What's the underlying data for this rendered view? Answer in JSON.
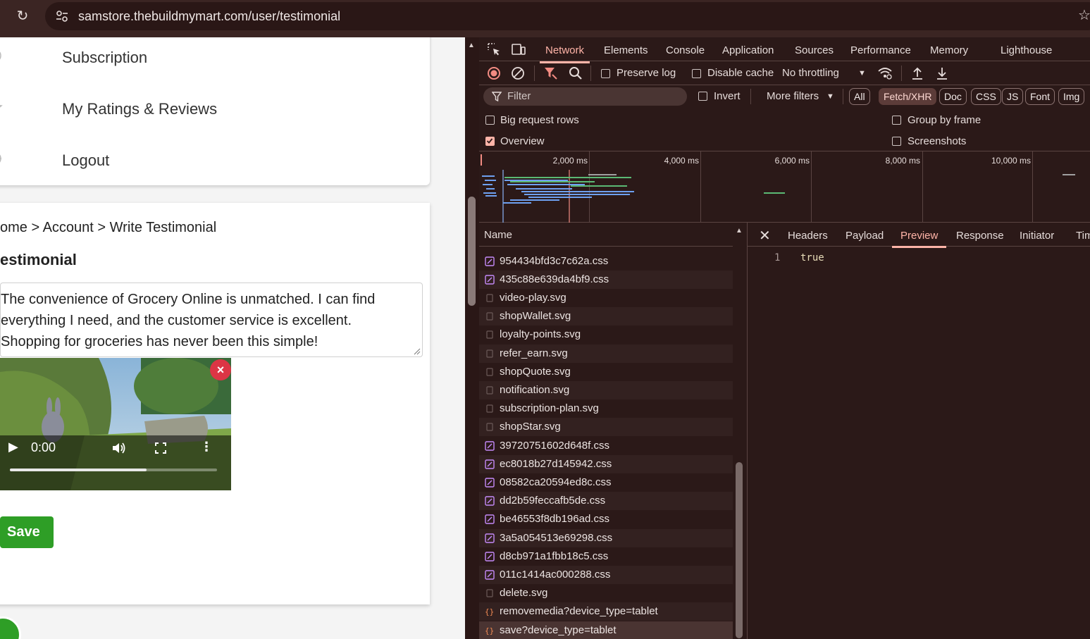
{
  "browser": {
    "url": "samstore.thebuildmymart.com/user/testimonial"
  },
  "account_menu": {
    "items": [
      {
        "label": "Subscription"
      },
      {
        "label": "My Ratings & Reviews"
      },
      {
        "label": "Logout"
      }
    ]
  },
  "testimonial": {
    "breadcrumb": "ome > Account > Write Testimonial",
    "title": "estimonial",
    "text_lines": [
      "The convenience of Grocery Online is unmatched. I can find",
      "everything I need, and the customer service is excellent.",
      "Shopping for groceries has never been this simple!"
    ],
    "video": {
      "time": "0:00",
      "progress": 0.66
    },
    "remove_icon": "×",
    "save_label": "Save"
  },
  "devtools": {
    "tabs": [
      "Network",
      "Elements",
      "Console",
      "Application",
      "Sources",
      "Performance",
      "Memory",
      "Lighthouse"
    ],
    "active_tab": "Network",
    "toolbar": {
      "preserve_log": "Preserve log",
      "disable_cache": "Disable cache",
      "throttling": "No throttling"
    },
    "filter": {
      "placeholder": "Filter",
      "invert": "Invert",
      "more_filters": "More filters",
      "chips": [
        "All",
        "Fetch/XHR",
        "Doc",
        "CSS",
        "JS",
        "Font",
        "Img"
      ],
      "active_chip": "Fetch/XHR"
    },
    "options": {
      "big_request_rows": "Big request rows",
      "group_by_frame": "Group by frame",
      "overview": "Overview",
      "screenshots": "Screenshots",
      "overview_checked": true
    },
    "overview_ticks": [
      "2,000 ms",
      "4,000 ms",
      "6,000 ms",
      "8,000 ms",
      "10,000 ms"
    ],
    "list_header": "Name",
    "requests": [
      {
        "name": "954434bfd3c7c62a.css",
        "type": "css"
      },
      {
        "name": "435c88e639da4bf9.css",
        "type": "css"
      },
      {
        "name": "video-play.svg",
        "type": "svg"
      },
      {
        "name": "shopWallet.svg",
        "type": "svg"
      },
      {
        "name": "loyalty-points.svg",
        "type": "svg"
      },
      {
        "name": "refer_earn.svg",
        "type": "svg"
      },
      {
        "name": "shopQuote.svg",
        "type": "svg"
      },
      {
        "name": "notification.svg",
        "type": "svg"
      },
      {
        "name": "subscription-plan.svg",
        "type": "svg"
      },
      {
        "name": "shopStar.svg",
        "type": "svg"
      },
      {
        "name": "39720751602d648f.css",
        "type": "css"
      },
      {
        "name": "ec8018b27d145942.css",
        "type": "css"
      },
      {
        "name": "08582ca20594ed8c.css",
        "type": "css"
      },
      {
        "name": "dd2b59feccafb5de.css",
        "type": "css"
      },
      {
        "name": "be46553f8db196ad.css",
        "type": "css"
      },
      {
        "name": "3a5a054513e69298.css",
        "type": "css"
      },
      {
        "name": "d8cb971a1fbb18c5.css",
        "type": "css"
      },
      {
        "name": "011c1414ac000288.css",
        "type": "css"
      },
      {
        "name": "delete.svg",
        "type": "svg"
      },
      {
        "name": "removemedia?device_type=tablet",
        "type": "xhr"
      },
      {
        "name": "save?device_type=tablet",
        "type": "xhr",
        "selected": true
      }
    ],
    "detail_tabs": [
      "Headers",
      "Payload",
      "Preview",
      "Response",
      "Initiator",
      "Tim"
    ],
    "active_detail_tab": "Preview",
    "preview": {
      "line_number": "1",
      "value": "true"
    },
    "colors": {
      "accent": "#ffb4a8",
      "css_icon": "#c58af9",
      "xhr_icon": "#f28b54"
    }
  }
}
